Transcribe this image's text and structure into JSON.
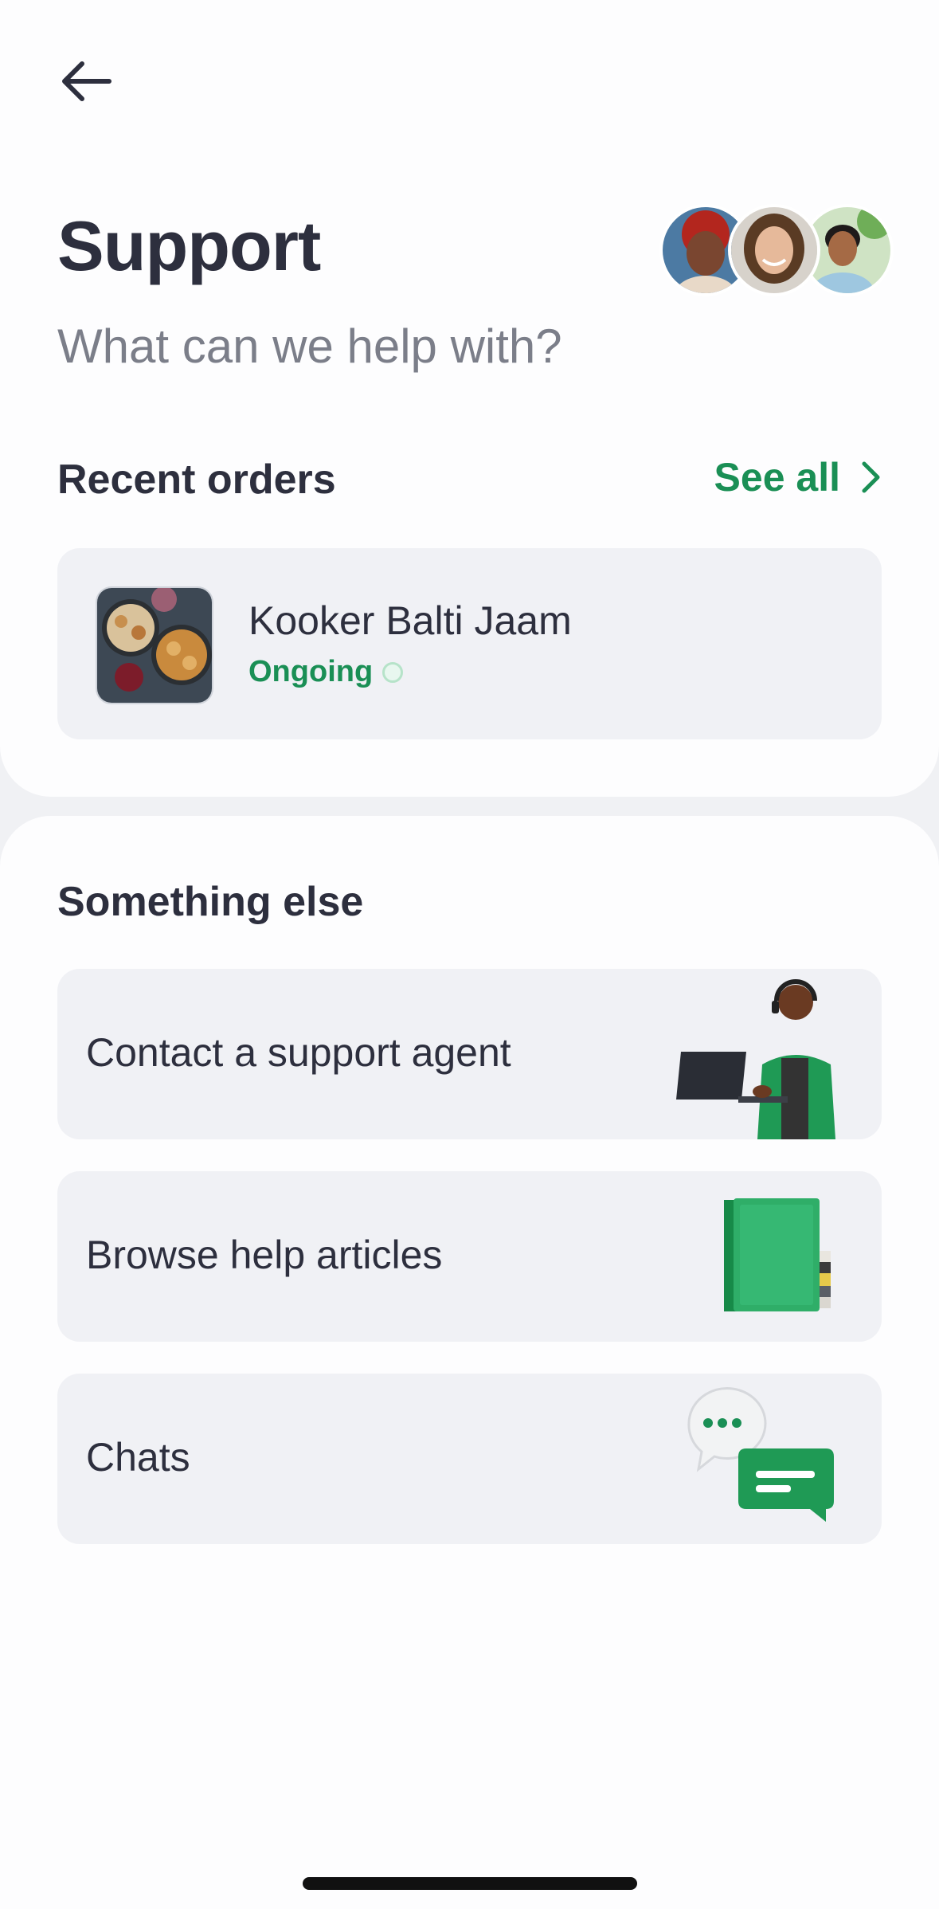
{
  "header": {
    "back_icon": "arrow-left-icon",
    "title": "Support",
    "subtitle": "What can we help with?",
    "avatars": [
      "avatar-agent-1",
      "avatar-agent-2",
      "avatar-agent-3"
    ]
  },
  "recent_orders": {
    "title": "Recent orders",
    "see_all_label": "See all",
    "see_all_icon": "chevron-right-icon",
    "orders": [
      {
        "name": "Kooker Balti Jaam",
        "status": "Ongoing"
      }
    ]
  },
  "something_else": {
    "title": "Something else",
    "options": [
      {
        "label": "Contact a support agent",
        "illustration": "support-agent-illustration"
      },
      {
        "label": "Browse help articles",
        "illustration": "books-illustration"
      },
      {
        "label": "Chats",
        "illustration": "chat-bubbles-illustration"
      }
    ]
  },
  "colors": {
    "accent": "#1a8f55",
    "text": "#2d2f3e",
    "muted": "#7b7e89",
    "card": "#f0f1f5",
    "page_bg": "#f0f1f4"
  }
}
